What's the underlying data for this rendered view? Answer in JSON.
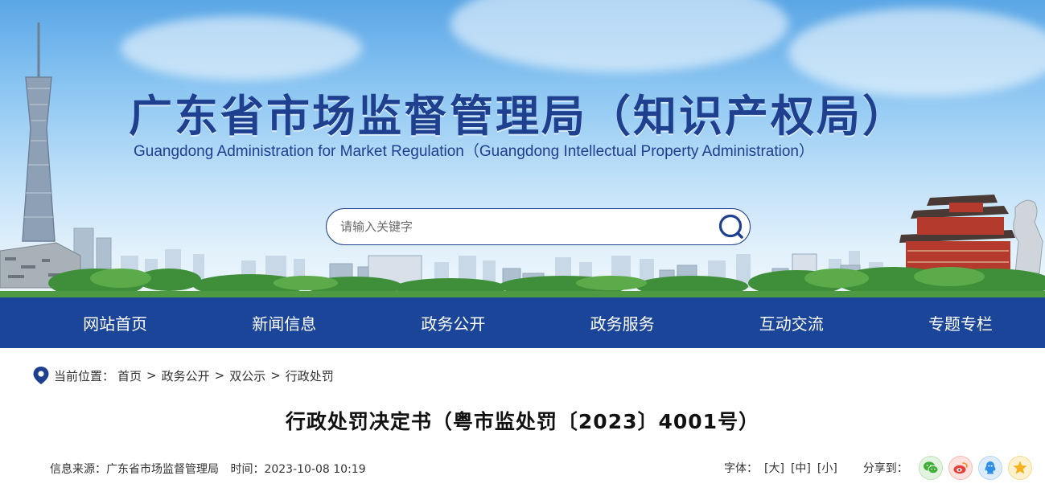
{
  "header": {
    "title_cn": "广东省市场监督管理局（知识产权局）",
    "title_en": "Guangdong Administration for Market Regulation（Guangdong Intellectual Property Administration）",
    "search": {
      "placeholder": "请输入关键字",
      "value": "",
      "icon": "search-icon"
    }
  },
  "nav": {
    "items": [
      {
        "label": "网站首页"
      },
      {
        "label": "新闻信息"
      },
      {
        "label": "政务公开"
      },
      {
        "label": "政务服务"
      },
      {
        "label": "互动交流"
      },
      {
        "label": "专题专栏"
      }
    ]
  },
  "breadcrumb": {
    "icon": "location-pin-icon",
    "prefix": "当前位置：",
    "items": [
      "首页",
      "政务公开",
      "双公示",
      "行政处罚"
    ],
    "separator": ">"
  },
  "article": {
    "title": "行政处罚决定书（粤市监处罚〔2023〕4001号）",
    "source_label": "信息来源：广东省市场监督管理局",
    "time_label": "时间：2023-10-08 10:19"
  },
  "tools": {
    "font_label": "字体：",
    "font_sizes": [
      "[大]",
      "[中]",
      "[小]"
    ],
    "share_label": "分享到：",
    "share_icons": [
      "wechat-icon",
      "weibo-icon",
      "qq-icon",
      "qzone-icon"
    ]
  },
  "colors": {
    "nav_bg": "#1a4598",
    "title_blue": "#1f3f8f"
  }
}
